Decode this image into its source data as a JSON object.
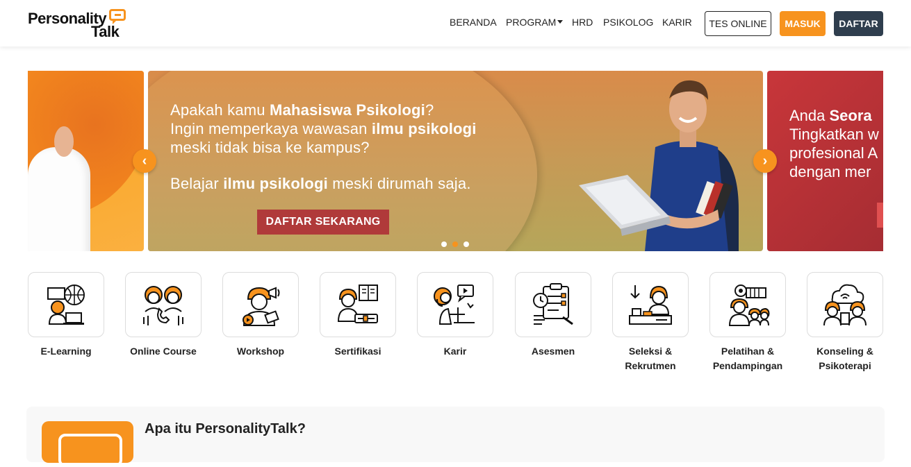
{
  "brand": {
    "line1": "Personality",
    "line2": "Talk"
  },
  "nav": {
    "beranda": "BERANDA",
    "program": "PROGRAM",
    "hrd": "HRD",
    "psikolog": "PSIKOLOG",
    "karir": "KARIR"
  },
  "buttons": {
    "tes_online": "TES ONLINE",
    "masuk": "MASUK",
    "daftar": "DAFTAR"
  },
  "carousel": {
    "main": {
      "line1_a": "Apakah kamu ",
      "line1_b": "Mahasiswa Psikologi",
      "line1_c": "?",
      "line2_a": "Ingin memperkaya wawasan ",
      "line2_b": "ilmu psikologi",
      "line3": "meski tidak bisa ke kampus?",
      "line4_a": "Belajar ",
      "line4_b": "ilmu psikologi",
      "line4_c": " meski dirumah saja.",
      "cta": "DAFTAR SEKARANG"
    },
    "right": {
      "line1_a": "Anda ",
      "line1_b": "Seora",
      "line2": "Tingkatkan w",
      "line3": "profesional A",
      "line4": "dengan mer"
    },
    "active_dot": 1
  },
  "categories": [
    {
      "label": "E-Learning",
      "icon": "e-learning-icon"
    },
    {
      "label": "Online Course",
      "icon": "online-course-icon"
    },
    {
      "label": "Workshop",
      "icon": "workshop-icon"
    },
    {
      "label": "Sertifikasi",
      "icon": "certification-icon"
    },
    {
      "label": "Karir",
      "icon": "career-icon"
    },
    {
      "label": "Asesmen",
      "icon": "assessment-icon"
    },
    {
      "label": "Seleksi & Rekrutmen",
      "icon": "recruitment-icon"
    },
    {
      "label": "Pelatihan & Pendampingan",
      "icon": "training-icon"
    },
    {
      "label": "Konseling & Psikoterapi",
      "icon": "counseling-icon"
    }
  ],
  "about": {
    "title": "Apa itu PersonalityTalk?"
  },
  "colors": {
    "accent": "#f7931e",
    "dark": "#2f3e4e",
    "cta": "#b03a3a"
  }
}
